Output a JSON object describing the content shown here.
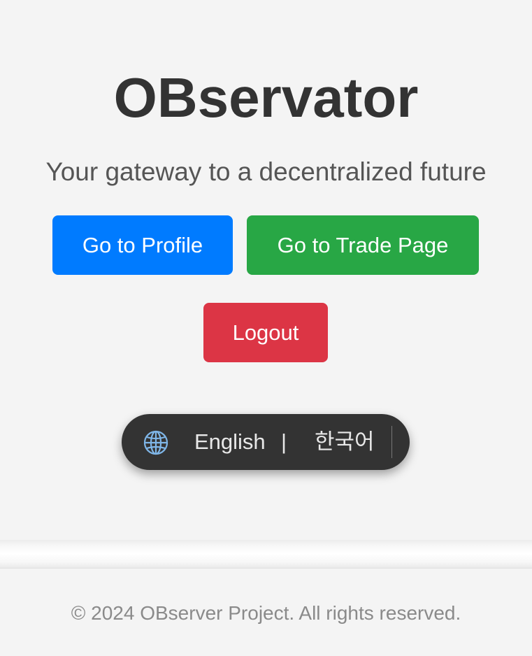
{
  "hero": {
    "title": "OBservator",
    "subtitle": "Your gateway to a decentralized future"
  },
  "actions": {
    "profile_label": "Go to Profile",
    "trade_label": "Go to Trade Page",
    "logout_label": "Logout"
  },
  "language_switcher": {
    "icon": "globe-icon",
    "english_label": "English",
    "separator": "|",
    "korean_label": "한국어"
  },
  "footer": {
    "copyright": "© 2024 OBserver Project. All rights reserved."
  },
  "colors": {
    "background": "#f4f4f4",
    "title": "#333333",
    "profile_button": "#007bff",
    "trade_button": "#28a745",
    "logout_button": "#dc3545",
    "switcher_background": "#333333",
    "globe": "#7fb6e8",
    "footer_text": "#8a8a8a"
  }
}
